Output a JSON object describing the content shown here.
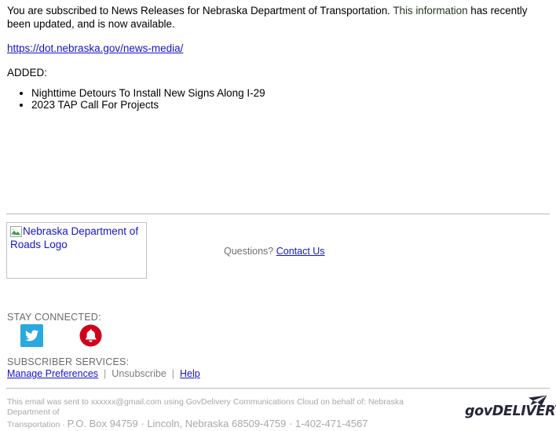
{
  "message": {
    "intro_before": "You are subscribed to News Releases for Nebraska Department of Transportation. ",
    "intro_highlight": "This information",
    "intro_after": " has recently been updated, and is now available.",
    "url_text": "https://dot.nebraska.gov/news-media/",
    "added_label": "ADDED:",
    "added_items": [
      "Nighttime Detours To Install New Signs Along I-29",
      "2023 TAP Call For Projects"
    ]
  },
  "branding": {
    "logo_alt_text": "Nebraska Department of Roads Logo",
    "broken_image_icon": "broken-image-icon"
  },
  "questions": {
    "prompt": "Questions?",
    "link_label": "Contact Us"
  },
  "stay_connected": {
    "label": "STAY CONNECTED:",
    "icons": [
      {
        "name": "twitter-icon",
        "color": "#28a9e0"
      },
      {
        "name": "bell-icon",
        "color": "#d0021b"
      }
    ]
  },
  "subscriber_services": {
    "label": "SUBSCRIBER SERVICES:",
    "manage_label": "Manage Preferences",
    "separator": "|",
    "unsubscribe_label": "Unsubscribe",
    "help_label": "Help"
  },
  "footer": {
    "line1": "This email was sent to xxxxxx@gmail.com using GovDelivery Communications Cloud on behalf of: Nebraska Department of",
    "line2_small": "Transportation · ",
    "line2_big": "P.O. Box 94759 · Lincoln, Nebraska 68509-4759 · 1-402-471-4567",
    "brand_name": "govDELIVERY",
    "brand_icon": "envelope-icon"
  },
  "colors": {
    "link": "#1414c8",
    "muted_text": "#6b6b6b",
    "footer_text": "#a8a8a8",
    "rule": "#b9b9b9",
    "brand_navy": "#26263c"
  }
}
